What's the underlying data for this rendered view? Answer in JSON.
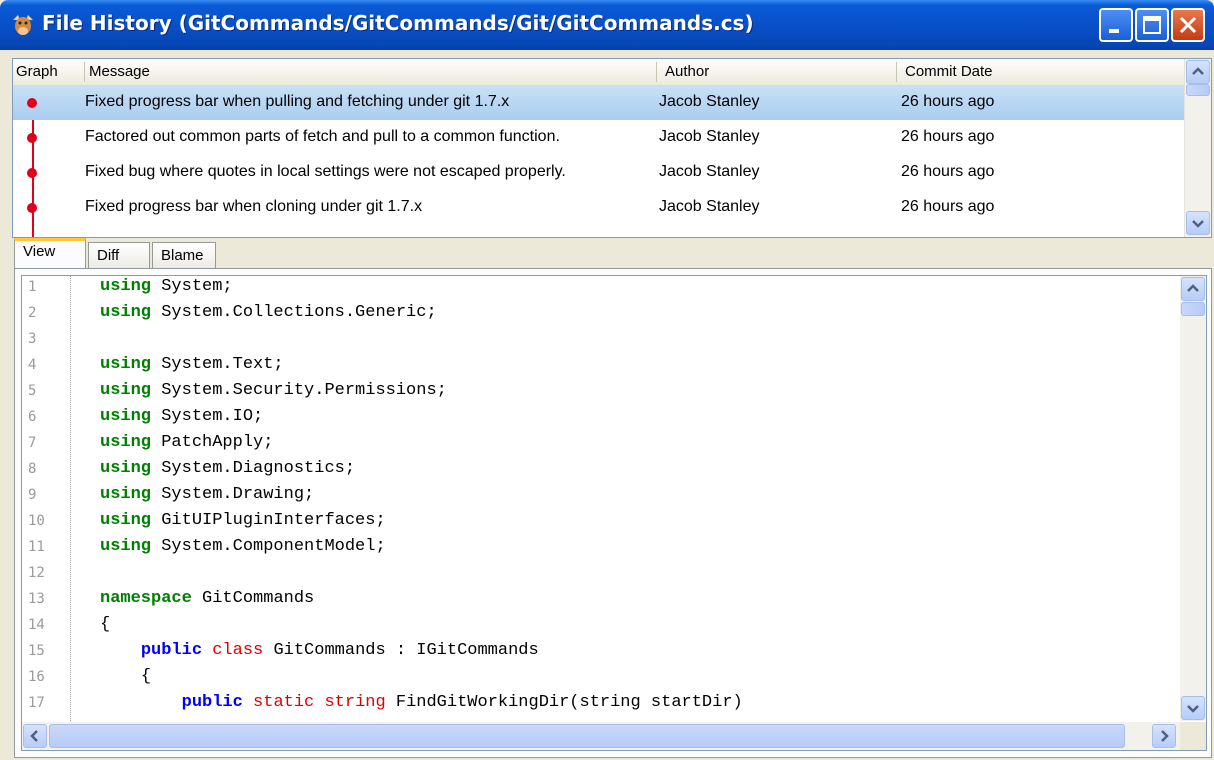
{
  "window": {
    "title": "File History (GitCommands/GitCommands/Git/GitCommands.cs)",
    "icon": "gitextensions-cow-icon",
    "controls": [
      "minimize-icon",
      "maximize-icon",
      "close-icon"
    ]
  },
  "history": {
    "columns": [
      "Graph",
      "Message",
      "Author",
      "Commit Date"
    ],
    "rows": [
      {
        "message": "Fixed progress bar when pulling and fetching under git 1.7.x",
        "author": "Jacob Stanley",
        "date": "26 hours ago",
        "selected": true
      },
      {
        "message": "Factored out common parts of fetch and pull to a common function.",
        "author": "Jacob Stanley",
        "date": "26 hours ago",
        "selected": false
      },
      {
        "message": "Fixed bug where quotes in local settings were not escaped properly.",
        "author": "Jacob Stanley",
        "date": "26 hours ago",
        "selected": false
      },
      {
        "message": "Fixed progress bar when cloning under git 1.7.x",
        "author": "Jacob Stanley",
        "date": "26 hours ago",
        "selected": false
      }
    ],
    "graph_color": "#e0001c",
    "selection_color": "#b7d6f2"
  },
  "tabs": [
    {
      "label": "View",
      "active": true
    },
    {
      "label": "Diff",
      "active": false
    },
    {
      "label": "Blame",
      "active": false
    }
  ],
  "code": {
    "line_numbers": [
      "1",
      "2",
      "3",
      "4",
      "5",
      "6",
      "7",
      "8",
      "9",
      "10",
      "11",
      "12",
      "13",
      "14",
      "15",
      "16",
      "17"
    ],
    "lines": [
      {
        "kw": "using",
        "rest": " System;"
      },
      {
        "kw": "using",
        "rest": " System.Collections.Generic;"
      },
      {
        "kw": "",
        "rest": ""
      },
      {
        "kw": "using",
        "rest": " System.Text;"
      },
      {
        "kw": "using",
        "rest": " System.Security.Permissions;"
      },
      {
        "kw": "using",
        "rest": " System.IO;"
      },
      {
        "kw": "using",
        "rest": " PatchApply;"
      },
      {
        "kw": "using",
        "rest": " System.Diagnostics;"
      },
      {
        "kw": "using",
        "rest": " System.Drawing;"
      },
      {
        "kw": "using",
        "rest": " GitUIPluginInterfaces;"
      },
      {
        "kw": "using",
        "rest": " System.ComponentModel;"
      },
      {
        "kw": "",
        "rest": ""
      },
      {
        "kw": "namespace",
        "rest": " GitCommands"
      },
      {
        "kw": "",
        "rest": "{"
      },
      {
        "kw": "public",
        "kw2": "class",
        "rest": " GitCommands : IGitCommands",
        "indent": "    "
      },
      {
        "kw": "",
        "rest": "{",
        "indent": "    "
      },
      {
        "kw": "public",
        "kw2": "static string",
        "rest": " FindGitWorkingDir(string startDir)",
        "indent": "        "
      }
    ],
    "keyword_color": "#008000",
    "modifier_color": "#0000ff",
    "type_color": "#e00000"
  }
}
